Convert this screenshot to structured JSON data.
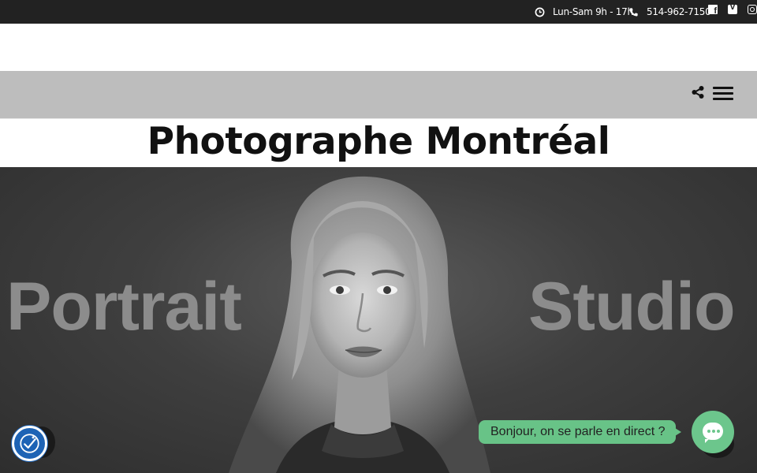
{
  "topbar": {
    "hours_icon": "clock-icon",
    "hours": "Lun-Sam 9h - 17h",
    "phone_icon": "phone-icon",
    "phone": "514-962-7150",
    "social": [
      "facebook-icon",
      "vimeo-icon",
      "instagram-icon"
    ]
  },
  "header": {
    "share_icon": "share-icon",
    "menu_icon": "hamburger-menu-icon"
  },
  "page": {
    "title": "Photographe Montréal"
  },
  "hero": {
    "word_left": "Portrait",
    "word_right": "Studio"
  },
  "widgets": {
    "accessibility_icon": "accessibility-icon",
    "chat_prompt": "Bonjour, on se parle en direct ?",
    "chat_icon": "chat-icon"
  },
  "colors": {
    "topbar_bg": "#222222",
    "navbar_bg": "#bdbdbd",
    "accessibility_blue": "#1d63b5",
    "chat_green": "#68c387"
  }
}
